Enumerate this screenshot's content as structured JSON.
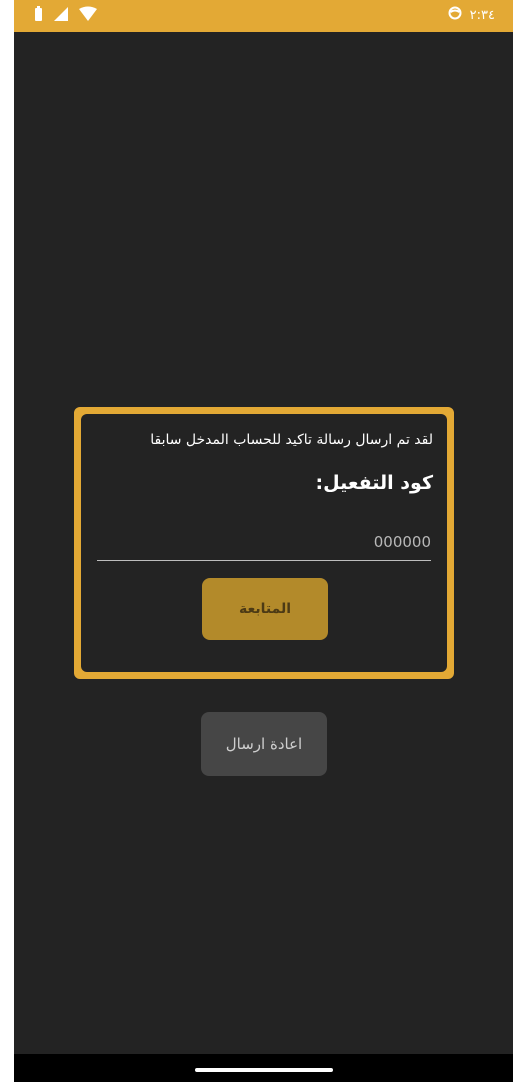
{
  "status_bar": {
    "time": "٢:٣٤",
    "background_color": "#e3a935",
    "icons": [
      "battery-icon",
      "signal-icon",
      "wifi-icon",
      "notification-circle-icon"
    ]
  },
  "card": {
    "message": "لقد تم ارسال رسالة تاكيد للحساب المدخل سابقا",
    "activation_label": "كود التفعيل:",
    "code_input": {
      "placeholder": "000000",
      "value": ""
    },
    "continue_label": "المتابعة",
    "border_color": "#e3a935",
    "button_color": "#b38a2a"
  },
  "resend_label": "اعادة ارسال",
  "colors": {
    "background": "#232323",
    "resend_button": "#464646"
  }
}
